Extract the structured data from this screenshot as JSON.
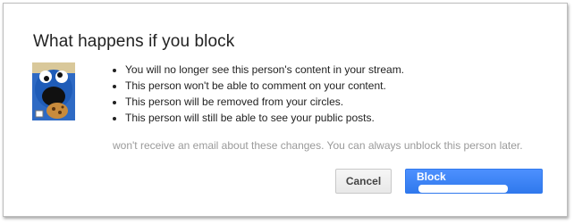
{
  "dialog": {
    "title": "What happens if you block",
    "bullets": [
      "You will no longer see this person's content in your stream.",
      "This person won't be able to comment on your content.",
      "This person will be removed from your circles.",
      "This person will still be able to see your public posts."
    ],
    "note": "won't receive an email about these changes. You can always unblock this person later.",
    "cancel_label": "Cancel",
    "block_label": "Block"
  },
  "colors": {
    "primary_button": "#4d90fe",
    "note_text": "#9a9a9a"
  }
}
